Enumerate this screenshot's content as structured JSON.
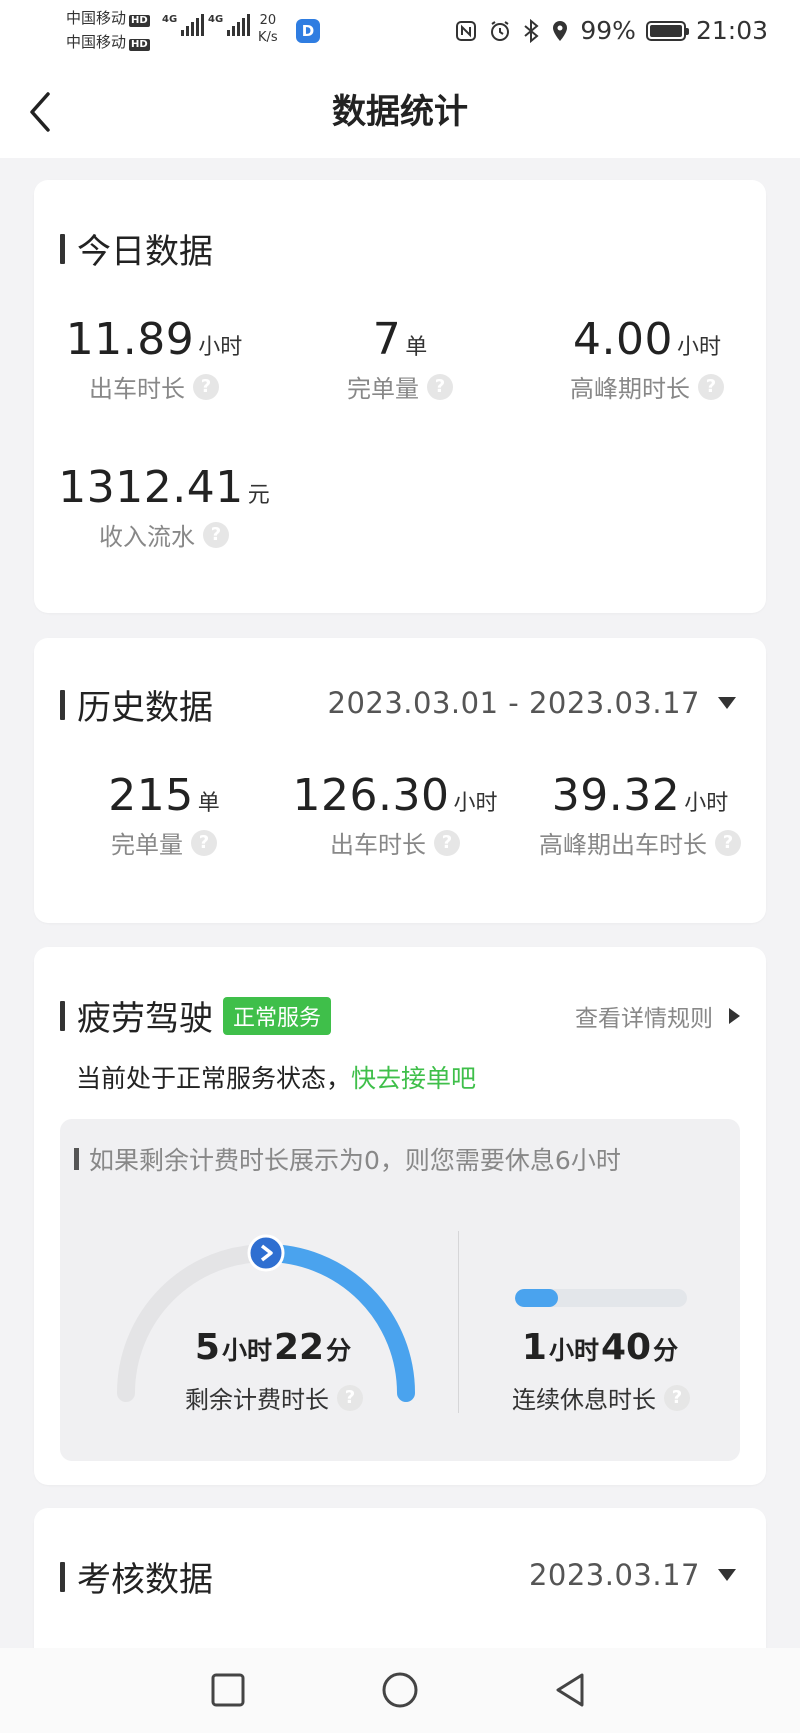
{
  "status_bar": {
    "carrier1": "中国移动",
    "carrier2": "中国移动",
    "hd": "HD",
    "net1": "4G",
    "net2": "4G",
    "speed_value": "20",
    "speed_unit": "K/s",
    "app_badge": "D",
    "battery": "99%",
    "battery_level": 0.99,
    "time": "21:03"
  },
  "header": {
    "title": "数据统计"
  },
  "today": {
    "title": "今日数据",
    "stats": [
      {
        "value": "11.89",
        "unit": "小时",
        "label": "出车时长"
      },
      {
        "value": "7",
        "unit": "单",
        "label": "完单量"
      },
      {
        "value": "4.00",
        "unit": "小时",
        "label": "高峰期时长"
      },
      {
        "value": "1312.41",
        "unit": "元",
        "label": "收入流水"
      }
    ]
  },
  "history": {
    "title": "历史数据",
    "date_range": "2023.03.01 - 2023.03.17",
    "stats": [
      {
        "value": "215",
        "unit": "单",
        "label": "完单量"
      },
      {
        "value": "126.30",
        "unit": "小时",
        "label": "出车时长"
      },
      {
        "value": "39.32",
        "unit": "小时",
        "label": "高峰期出车时长"
      }
    ]
  },
  "fatigue": {
    "title": "疲劳驾驶",
    "badge": "正常服务",
    "rule_link": "查看详情规则",
    "status_text": "当前处于正常服务状态，",
    "status_action": "快去接单吧",
    "hint": "如果剩余计费时长展示为0，则您需要休息6小时",
    "remaining": {
      "h": "5",
      "h_unit": "小时",
      "m": "22",
      "m_unit": "分",
      "label": "剩余计费时长",
      "fraction": 0.5
    },
    "rest": {
      "h": "1",
      "h_unit": "小时",
      "m": "40",
      "m_unit": "分",
      "label": "连续休息时长",
      "fraction": 0.25
    }
  },
  "assessment": {
    "title": "考核数据",
    "date": "2023.03.17"
  },
  "help_glyph": "?",
  "colors": {
    "accent_green": "#3fbf4a",
    "gauge_blue": "#4aa3ee",
    "gauge_marker": "#2f6fd1"
  }
}
